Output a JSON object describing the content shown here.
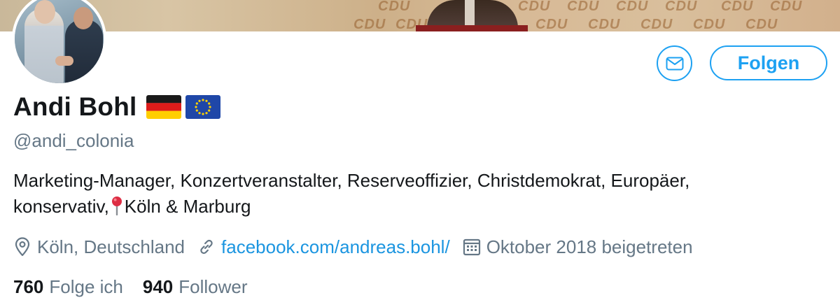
{
  "banner": {
    "stage_words": [
      "CDU",
      "CDU",
      "CDU",
      "CDU",
      "CDU",
      "CDU",
      "CDU",
      "CDU",
      "CDU",
      "CDU",
      "CDU",
      "CDU",
      "CDU",
      "CDU"
    ]
  },
  "profile": {
    "name": "Andi Bohl",
    "handle": "@andi_colonia",
    "bio_line1": "Marketing-Manager, Konzertveranstalter, Reserveoffizier, Christdemokrat, Europäer,",
    "bio_line2_a": "konservativ,",
    "bio_line2_b": "Köln & Marburg",
    "location": "Köln, Deutschland",
    "website": "facebook.com/andreas.bohl/",
    "joined": "Oktober 2018 beigetreten"
  },
  "actions": {
    "follow_label": "Folgen"
  },
  "stats": {
    "following_count": "760",
    "following_label": "Folge ich",
    "followers_count": "940",
    "followers_label": "Follower"
  },
  "icons": {
    "message": "envelope-icon",
    "location": "location-pin-icon",
    "link": "link-icon",
    "calendar": "calendar-icon",
    "bio_pin": "round-pushpin-emoji",
    "flags": [
      "germany-flag",
      "eu-flag"
    ]
  },
  "colors": {
    "accent": "#1da1f2",
    "link": "#1b95e0",
    "text": "#14171a",
    "secondary": "#657786"
  }
}
